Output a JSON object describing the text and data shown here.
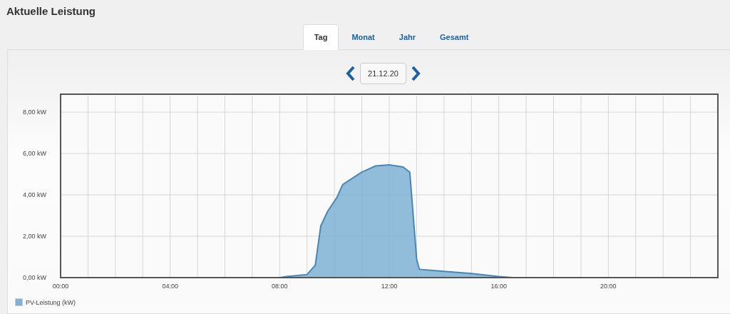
{
  "title": "Aktuelle Leistung",
  "tabs": [
    {
      "label": "Tag",
      "selected": true
    },
    {
      "label": "Monat",
      "selected": false
    },
    {
      "label": "Jahr",
      "selected": false
    },
    {
      "label": "Gesamt",
      "selected": false
    }
  ],
  "date_nav": {
    "value": "21.12.20"
  },
  "chart": {
    "chart_data": {
      "type": "area",
      "grid": true,
      "x": [
        0,
        8,
        8.25,
        9,
        9.3,
        9.5,
        9.75,
        10.1,
        10.3,
        11,
        11.5,
        12,
        12.5,
        12.75,
        13,
        13.1,
        14,
        15,
        16,
        16.5,
        24
      ],
      "series": [
        {
          "name": "PV-Leistung (kW)",
          "color": "#7fb2d4",
          "values": [
            0,
            0,
            0.05,
            0.15,
            0.6,
            2.5,
            3.2,
            3.9,
            4.5,
            5.1,
            5.4,
            5.45,
            5.35,
            5.1,
            0.9,
            0.4,
            0.3,
            0.2,
            0.05,
            0,
            0
          ]
        }
      ],
      "xlim": [
        0,
        24
      ],
      "ylim": [
        0,
        8.8
      ],
      "xticks": [
        {
          "value": 0,
          "label": "00:00"
        },
        {
          "value": 4,
          "label": "04:00"
        },
        {
          "value": 8,
          "label": "08:00"
        },
        {
          "value": 12,
          "label": "12:00"
        },
        {
          "value": 16,
          "label": "16:00"
        },
        {
          "value": 20,
          "label": "20:00"
        }
      ],
      "yticks": [
        {
          "value": 0,
          "label": "0,00 kW"
        },
        {
          "value": 2,
          "label": "2,00 kW"
        },
        {
          "value": 4,
          "label": "4,00 kW"
        },
        {
          "value": 6,
          "label": "6,00 kW"
        },
        {
          "value": 8,
          "label": "8,00 kW"
        }
      ]
    }
  }
}
